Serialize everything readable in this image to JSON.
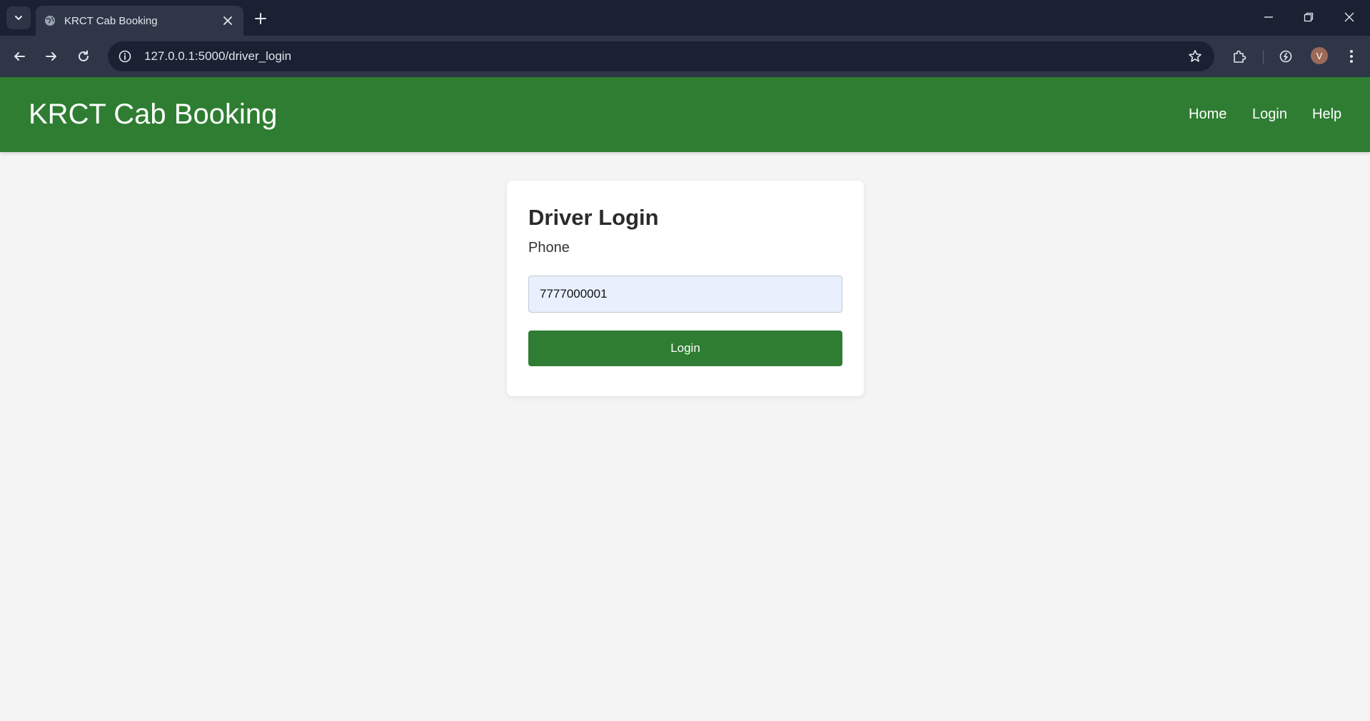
{
  "browser": {
    "tab_title": "KRCT Cab Booking",
    "url": "127.0.0.1:5000/driver_login",
    "profile_initial": "V"
  },
  "header": {
    "brand": "KRCT Cab Booking",
    "nav": [
      "Home",
      "Login",
      "Help"
    ]
  },
  "login_card": {
    "title": "Driver Login",
    "phone_label": "Phone",
    "phone_value": "7777000001",
    "submit_label": "Login"
  },
  "colors": {
    "header_green": "#2e7d32",
    "page_background": "#f4f4f4",
    "input_background": "#e8f0fe"
  }
}
